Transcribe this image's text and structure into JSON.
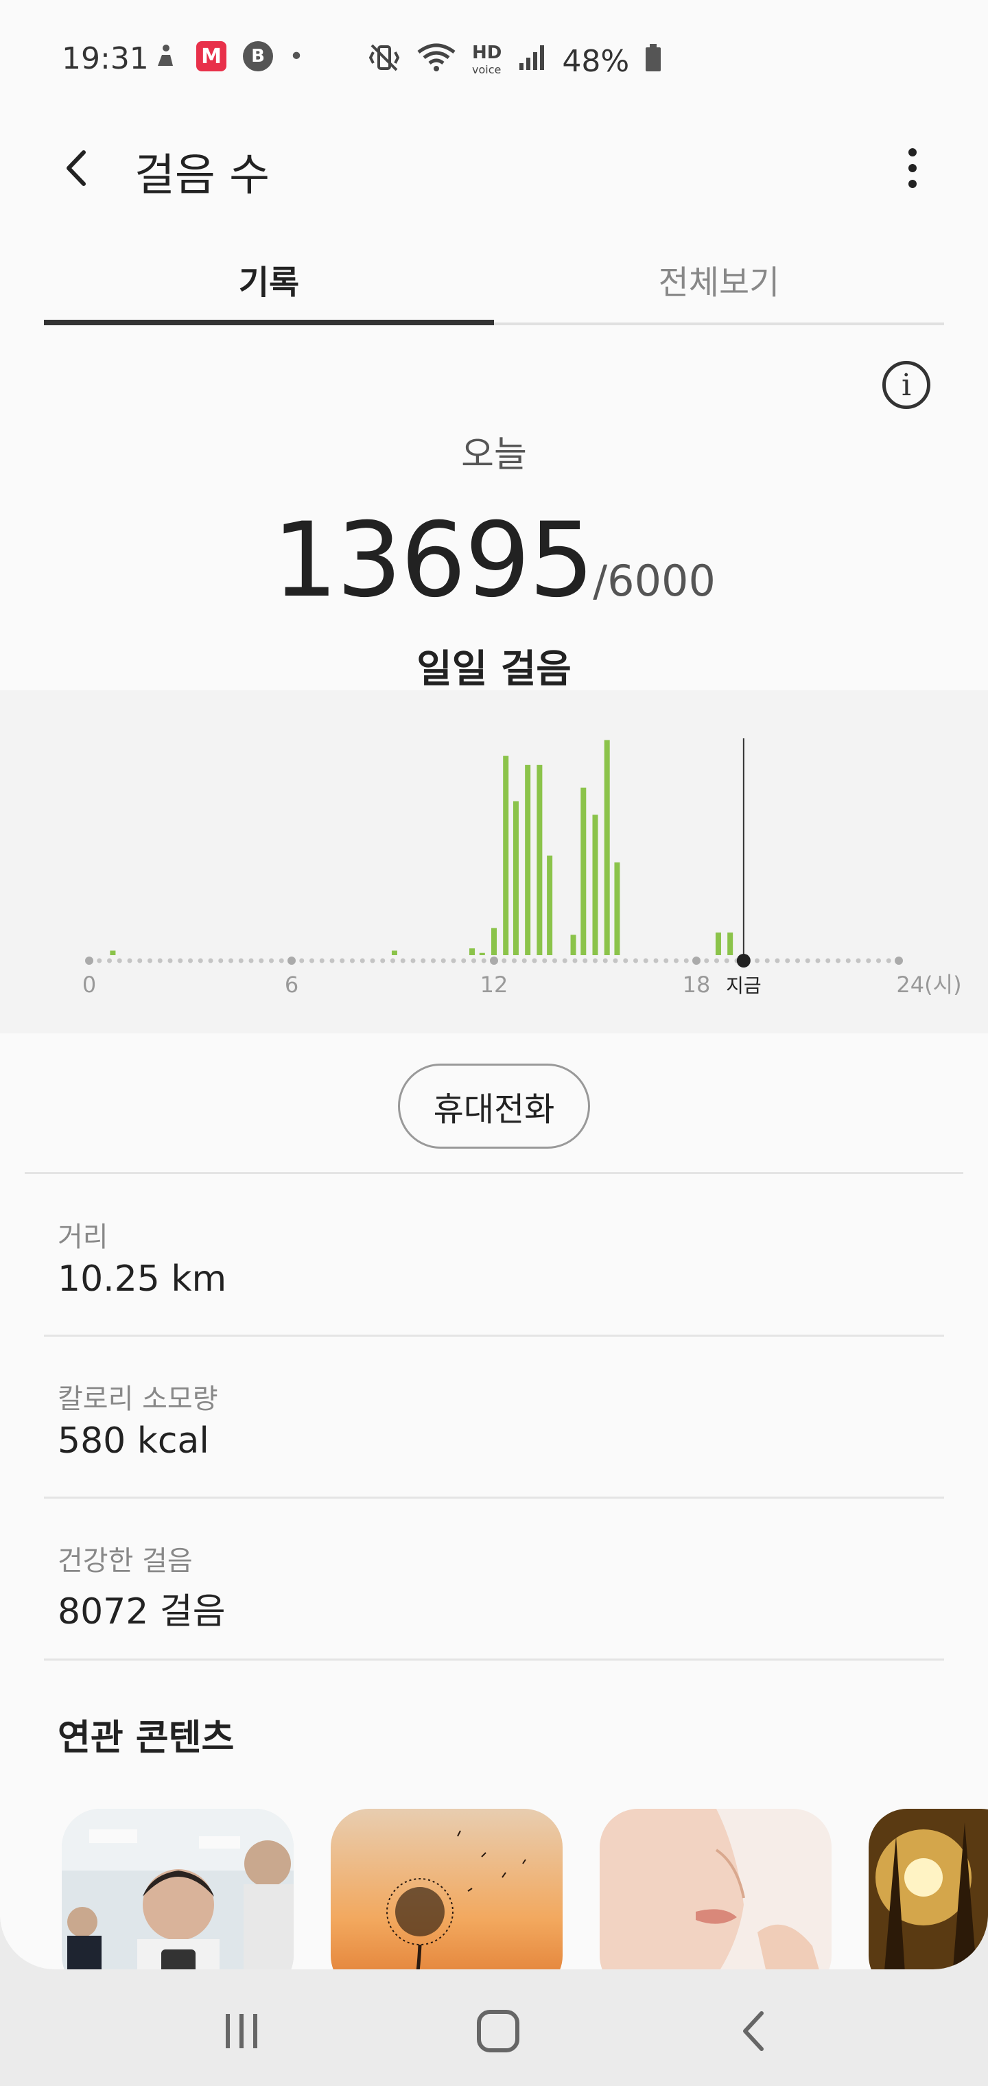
{
  "status_bar": {
    "time": "19:31",
    "battery_text": "48%",
    "icons": [
      "accessibility-icon",
      "app-m-icon",
      "app-b-icon",
      "dot-icon",
      "vibrate-icon",
      "wifi-icon",
      "hd-voice-icon",
      "signal-icon",
      "battery-icon"
    ]
  },
  "app_bar": {
    "title": "걸음 수"
  },
  "tabs": [
    {
      "label": "기록",
      "active": true
    },
    {
      "label": "전체보기",
      "active": false
    }
  ],
  "summary": {
    "day_label": "오늘",
    "steps": "13695",
    "goal": "/6000",
    "chart_title": "일일 걸음"
  },
  "chart_data": {
    "type": "bar",
    "x_unit": "hour",
    "xlim": [
      0,
      24
    ],
    "tick_labels": [
      "0",
      "6",
      "12",
      "18",
      "24(시)"
    ],
    "now_label": "지금",
    "now_hour": 19.4,
    "bar_color": "#8bc34a",
    "bars": [
      {
        "x": 0.7,
        "v": 0.02
      },
      {
        "x": 9.05,
        "v": 0.02
      },
      {
        "x": 11.35,
        "v": 0.03
      },
      {
        "x": 11.65,
        "v": 0.01
      },
      {
        "x": 12.0,
        "v": 0.12
      },
      {
        "x": 12.35,
        "v": 0.88
      },
      {
        "x": 12.65,
        "v": 0.68
      },
      {
        "x": 13.0,
        "v": 0.84
      },
      {
        "x": 13.35,
        "v": 0.84
      },
      {
        "x": 13.65,
        "v": 0.44
      },
      {
        "x": 14.35,
        "v": 0.09
      },
      {
        "x": 14.65,
        "v": 0.74
      },
      {
        "x": 15.0,
        "v": 0.62
      },
      {
        "x": 15.35,
        "v": 0.95
      },
      {
        "x": 15.65,
        "v": 0.41
      },
      {
        "x": 18.65,
        "v": 0.1
      },
      {
        "x": 19.0,
        "v": 0.1
      }
    ]
  },
  "device_button": "휴대전화",
  "stats": [
    {
      "label": "거리",
      "value": "10.25 km"
    },
    {
      "label": "칼로리 소모량",
      "value": "580 kcal"
    },
    {
      "label": "건강한 걸음",
      "value": "8072 걸음"
    }
  ],
  "related": {
    "title": "연관 콘텐츠"
  }
}
